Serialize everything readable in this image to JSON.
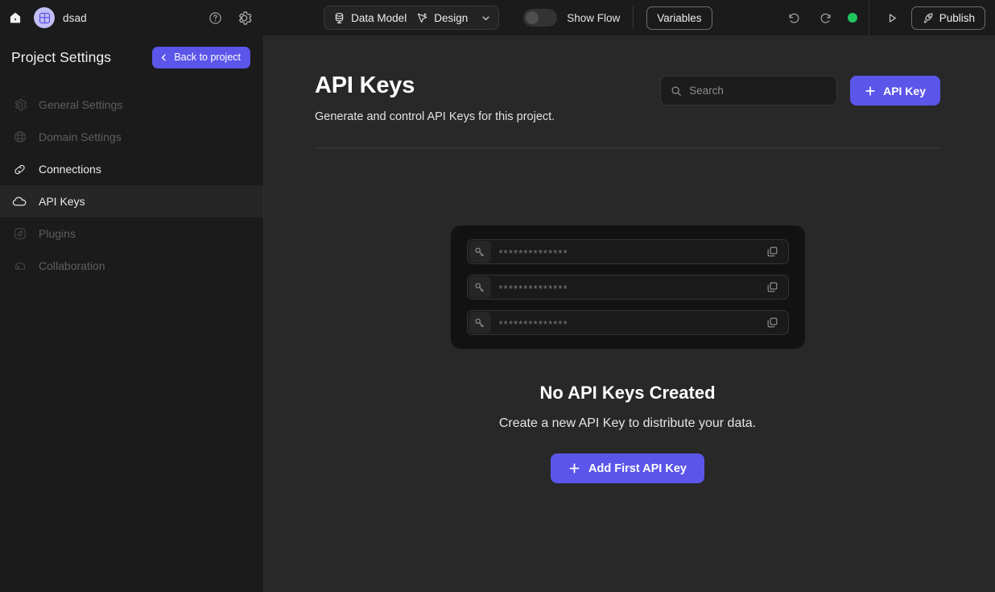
{
  "topbar": {
    "home_icon": "home-icon",
    "brand_icon": "grid-layout-icon",
    "project_name": "dsad",
    "help_icon": "help-circle-icon",
    "settings_icon": "gear-icon",
    "segments": [
      {
        "label": "Data Model",
        "icon": "database-icon"
      },
      {
        "label": "Design",
        "icon": "cursor-pointer-icon"
      }
    ],
    "caret_icon": "chevron-down-icon",
    "show_flow_label": "Show Flow",
    "show_flow_on": false,
    "variables_label": "Variables",
    "undo_icon": "undo-icon",
    "redo_icon": "redo-icon",
    "status_dot_color": "#22c55e",
    "play_icon": "play-icon",
    "publish_label": "Publish",
    "publish_icon": "rocket-icon"
  },
  "sidebar": {
    "title": "Project Settings",
    "back_label": "Back to project",
    "back_icon": "chevron-left-icon",
    "items": [
      {
        "label": "General Settings",
        "icon": "gear-icon",
        "state": "dim"
      },
      {
        "label": "Domain Settings",
        "icon": "globe-icon",
        "state": "dim"
      },
      {
        "label": "Connections",
        "icon": "link-icon",
        "state": "normal"
      },
      {
        "label": "API Keys",
        "icon": "cloud-icon",
        "state": "active"
      },
      {
        "label": "Plugins",
        "icon": "plugin-icon",
        "state": "dim"
      },
      {
        "label": "Collaboration",
        "icon": "collaboration-icon",
        "state": "dim"
      }
    ]
  },
  "main": {
    "title": "API Keys",
    "subtitle": "Generate and control API Keys for this project.",
    "search": {
      "placeholder": "Search",
      "value": "",
      "icon": "search-icon"
    },
    "add_key_button": {
      "label": "API Key",
      "icon": "plus-icon"
    },
    "illustration": {
      "rows": [
        {
          "icon": "key-icon",
          "mask": "**************",
          "copy_icon": "copy-icon"
        },
        {
          "icon": "key-icon",
          "mask": "**************",
          "copy_icon": "copy-icon"
        },
        {
          "icon": "key-icon",
          "mask": "**************",
          "copy_icon": "copy-icon"
        }
      ]
    },
    "empty_title": "No API Keys Created",
    "empty_subtitle": "Create a new API Key to distribute your data.",
    "empty_button": {
      "label": "Add First API Key",
      "icon": "plus-icon"
    }
  },
  "colors": {
    "accent": "#5b55ea",
    "brand_badge": "#c3bef5",
    "status_green": "#22c55e",
    "sidebar_bg": "#1b1b1b",
    "main_bg": "#282828",
    "card_bg": "#121212"
  }
}
